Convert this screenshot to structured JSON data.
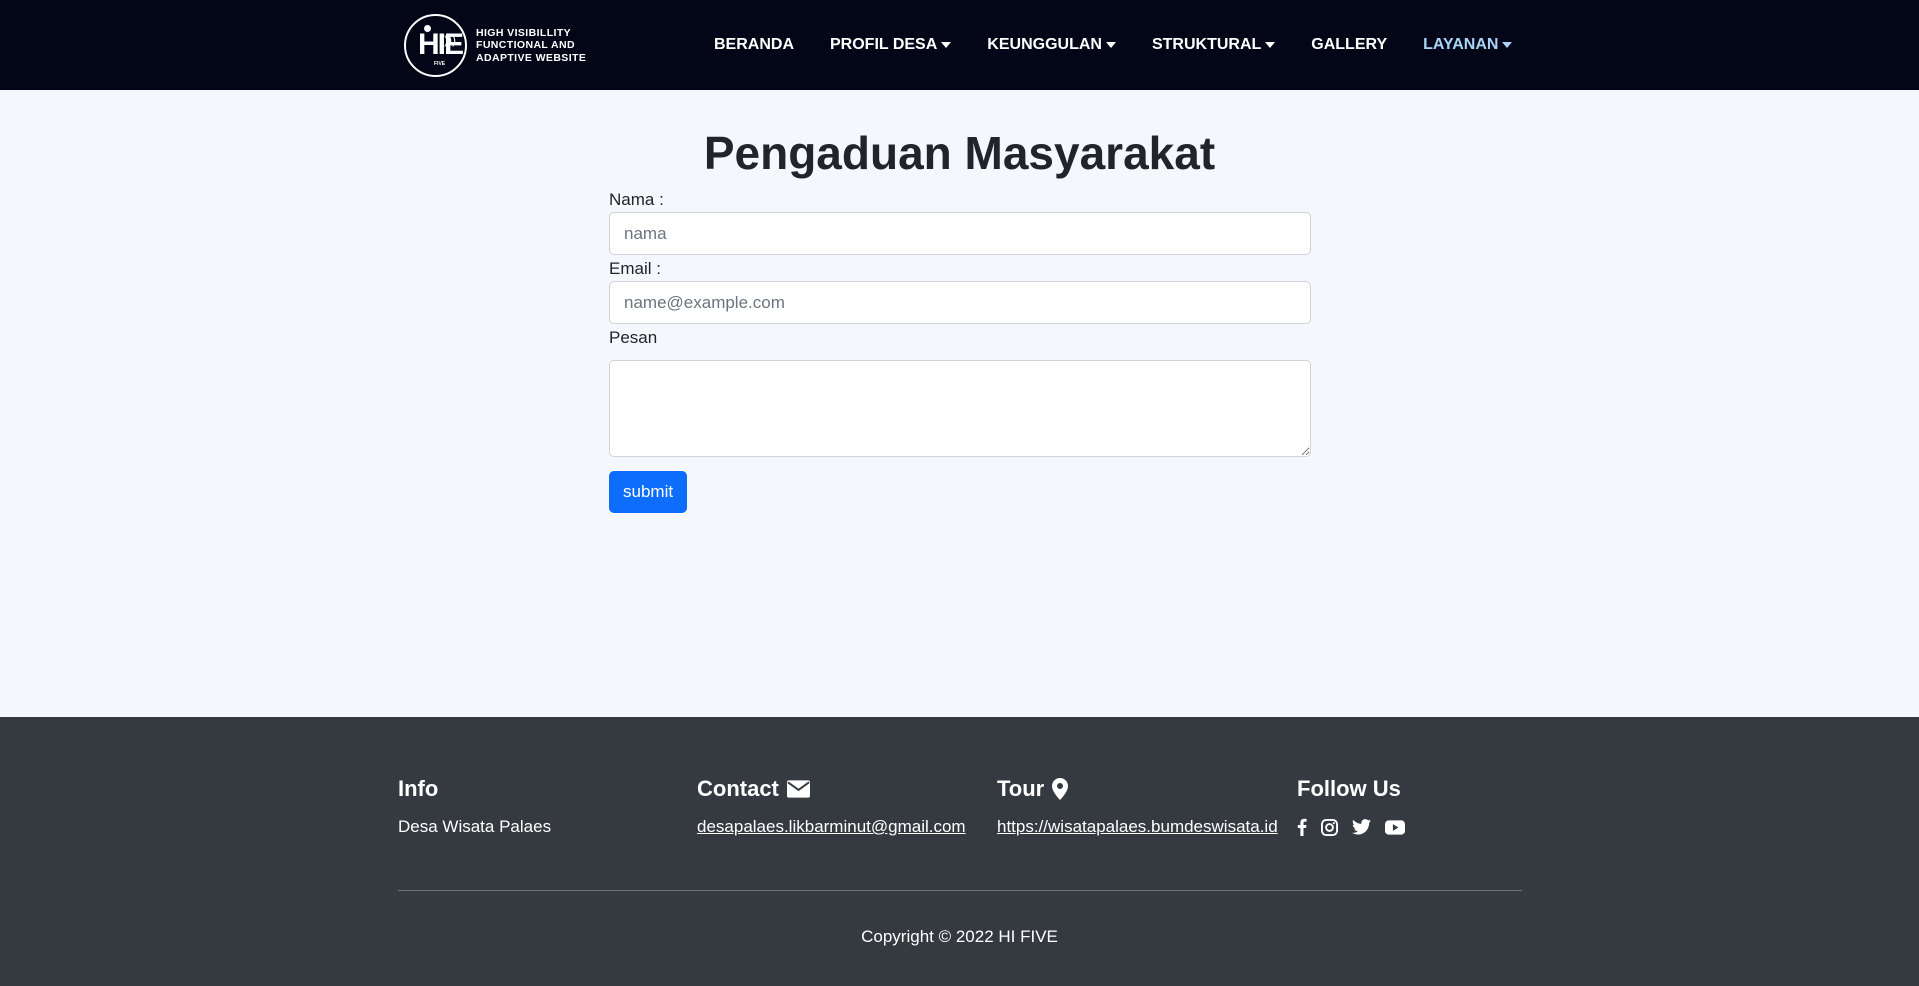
{
  "brand": {
    "logo_mark": "HIE",
    "logo_sub": "FIVE",
    "logo_text_lines": [
      "HIGH VISIBILLITY",
      "FUNCTIONAL AND",
      "ADAPTIVE WEBSITE"
    ]
  },
  "nav": {
    "items": [
      {
        "label": "BERANDA",
        "dropdown": false
      },
      {
        "label": "PROFIL DESA",
        "dropdown": true
      },
      {
        "label": "KEUNGGULAN",
        "dropdown": true
      },
      {
        "label": "STRUKTURAL",
        "dropdown": true
      },
      {
        "label": "GALLERY",
        "dropdown": false
      },
      {
        "label": "LAYANAN",
        "dropdown": true,
        "active": true
      }
    ],
    "active_color": "#a9d4f6"
  },
  "page": {
    "title": "Pengaduan Masyarakat"
  },
  "form": {
    "name_label": "Nama :",
    "name_placeholder": "nama",
    "name_value": "",
    "email_label": "Email :",
    "email_placeholder": "name@example.com",
    "email_value": "",
    "message_label": "Pesan",
    "message_value": "",
    "submit_label": "submit"
  },
  "footer": {
    "info_heading": "Info",
    "info_text": "Desa Wisata Palaes",
    "contact_heading": "Contact",
    "contact_email": "desapalaes.likbarminut@gmail.com",
    "tour_heading": "Tour",
    "tour_link": "https://wisatapalaes.bumdeswisata.id",
    "follow_heading": "Follow Us",
    "social_icons": [
      "facebook-icon",
      "instagram-icon",
      "twitter-icon",
      "youtube-icon"
    ],
    "copyright": "Copyright © 2022 HI FIVE"
  },
  "colors": {
    "navbar_bg": "#020617",
    "page_bg": "#f5f7fc",
    "footer_bg": "#343a40",
    "primary_button": "#0d6efd"
  }
}
